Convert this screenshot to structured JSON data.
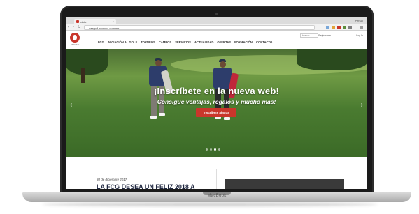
{
  "browser": {
    "tab_title": "Inicio",
    "tab_close": "×",
    "window_user": "Persal",
    "url": "caegolf.hemova.com.mx",
    "nav_back": "‹",
    "nav_forward": "›",
    "nav_reload": "↻"
  },
  "site": {
    "logo_text": "CEGOLF",
    "search_placeholder": "buscar...",
    "util_links": [
      "Registrarse",
      "Log In"
    ],
    "nav": [
      "FCG",
      "INICIACIÓN AL GOLF",
      "TORNEOS",
      "CAMPOS",
      "SERVICIOS",
      "ACTUALIDAD",
      "OFERTAS",
      "FORMACIÓN",
      "CONTACTO"
    ]
  },
  "hero": {
    "title": "¡Inscríbete en la nueva web!",
    "subtitle": "Consigue ventajas, regalos y mucho más!",
    "button": "Inscríbete ahora!",
    "prev_arrow": "‹",
    "next_arrow": "›",
    "slides_total": 4,
    "active_slide": 3
  },
  "post": {
    "date": "30 de diciembre 2017",
    "title": "LA FCG DESEA UN FELIZ 2018 A"
  },
  "device": {
    "label": "MacBook"
  },
  "colors": {
    "brand_red": "#c9362b",
    "laptop_frame": "#1a1a1a",
    "grass": "#4a7b30"
  }
}
